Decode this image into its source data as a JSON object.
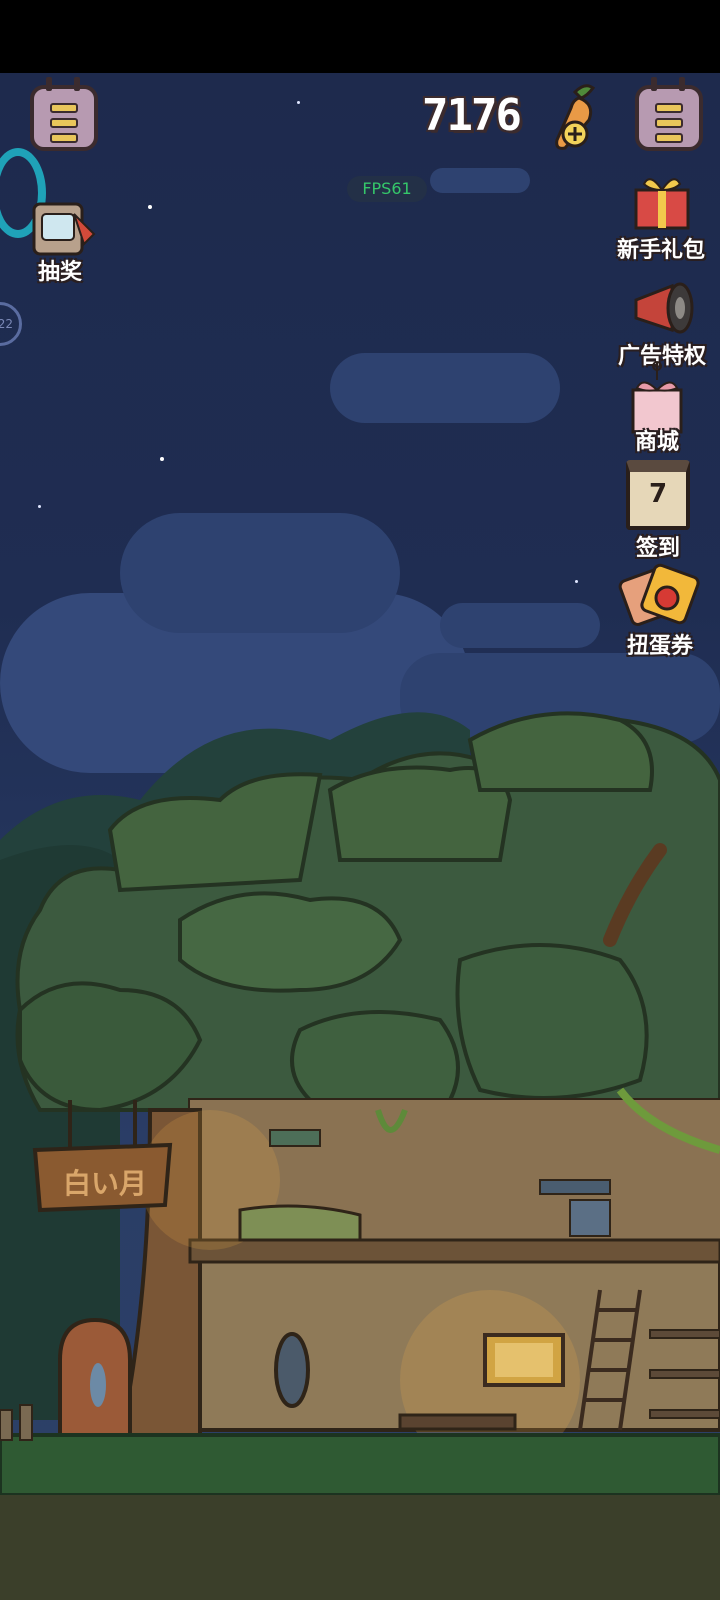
{
  "hud": {
    "currency_value": "7176",
    "fps_label": "FPS61"
  },
  "left_menu": {
    "lottery_label": "抽奖",
    "level_badge": "22"
  },
  "right_menu": {
    "items": [
      {
        "label": "新手礼包",
        "icon": "gift-box-icon"
      },
      {
        "label": "广告特权",
        "icon": "megaphone-icon"
      },
      {
        "label": "商城",
        "icon": "shop-gift-icon"
      },
      {
        "label": "签到",
        "icon": "calendar-icon",
        "calendar_day": "7"
      },
      {
        "label": "扭蛋券",
        "icon": "capsule-ticket-icon"
      }
    ]
  },
  "scene": {
    "shop_sign": "白い月"
  },
  "colors": {
    "sky": "#1f2d52",
    "foliage": "#3b5a3e",
    "trunk_wall": "#8a7555",
    "ground": "#2f5a33"
  }
}
